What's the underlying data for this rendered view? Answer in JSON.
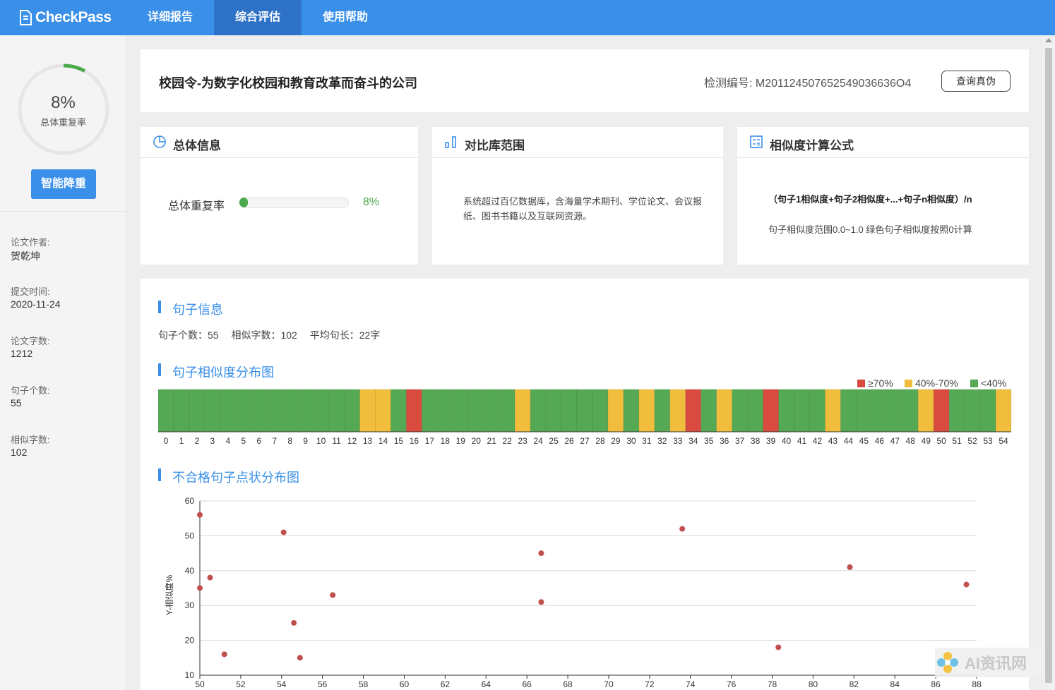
{
  "app": {
    "name": "CheckPass"
  },
  "nav": {
    "tabs": [
      "详细报告",
      "综合评估",
      "使用帮助"
    ],
    "active_tab": "综合评估"
  },
  "sidebar": {
    "overall_rate": "8%",
    "overall_rate_value": 0.08,
    "overall_label": "总体重复率",
    "reduce_button": "智能降重",
    "meta": [
      {
        "label": "论文作者:",
        "value": "贺乾坤"
      },
      {
        "label": "提交时间:",
        "value": "2020-11-24"
      },
      {
        "label": "论文字数:",
        "value": "1212"
      },
      {
        "label": "句子个数:",
        "value": "55"
      },
      {
        "label": "相似字数:",
        "value": "102"
      }
    ]
  },
  "header": {
    "title": "校园令-为数字化校园和教育改革而奋斗的公司",
    "id_label": "检测编号:",
    "id_value": "M201124507652549036636O4",
    "verify_button": "查询真伪"
  },
  "summary": {
    "title": "总体信息",
    "bar_label": "总体重复率",
    "bar_value": 0.08,
    "bar_pct": "8%"
  },
  "scope": {
    "title": "对比库范围",
    "text": "系统超过百亿数据库，含海量学术期刊、学位论文、会议报纸、图书书籍以及互联网资源。"
  },
  "formula": {
    "title": "相似度计算公式",
    "text": "（句子1相似度+句子2相似度+...+句子n相似度）/n",
    "note": "句子相似度范围0.0~1.0 绿色句子相似度按照0计算"
  },
  "sentence_info": {
    "heading": "句子信息",
    "stats": [
      "句子个数：55",
      "相似字数：102",
      "平均句长：22字"
    ]
  },
  "distribution": {
    "heading": "句子相似度分布图",
    "legend": [
      {
        "label": "≥70%",
        "color": "#d84b3e"
      },
      {
        "label": "40%-70%",
        "color": "#f0bd3c"
      },
      {
        "label": "<40%",
        "color": "#55a854"
      }
    ]
  },
  "scatter": {
    "heading": "不合格句子点状分布图"
  },
  "chart_data": [
    {
      "type": "bar",
      "title": "句子相似度分布图",
      "categories": [
        "0",
        "1",
        "2",
        "3",
        "4",
        "5",
        "6",
        "7",
        "8",
        "9",
        "10",
        "11",
        "12",
        "13",
        "14",
        "15",
        "16",
        "17",
        "18",
        "19",
        "20",
        "21",
        "22",
        "23",
        "24",
        "25",
        "26",
        "27",
        "28",
        "29",
        "30",
        "31",
        "32",
        "33",
        "34",
        "35",
        "36",
        "37",
        "38",
        "39",
        "40",
        "41",
        "42",
        "43",
        "44",
        "45",
        "46",
        "47",
        "48",
        "49",
        "50",
        "51",
        "52",
        "53",
        "54"
      ],
      "levels": [
        "green",
        "green",
        "green",
        "green",
        "green",
        "green",
        "green",
        "green",
        "green",
        "green",
        "green",
        "green",
        "green",
        "yellow",
        "yellow",
        "green",
        "red",
        "green",
        "green",
        "green",
        "green",
        "green",
        "green",
        "yellow",
        "green",
        "green",
        "green",
        "green",
        "green",
        "yellow",
        "green",
        "yellow",
        "green",
        "yellow",
        "red",
        "green",
        "yellow",
        "green",
        "green",
        "red",
        "green",
        "green",
        "green",
        "yellow",
        "green",
        "green",
        "green",
        "green",
        "green",
        "yellow",
        "red",
        "green",
        "green",
        "green",
        "yellow"
      ],
      "legend": [
        "≥70%",
        "40%-70%",
        "<40%"
      ],
      "colors": {
        "red": "#d84b3e",
        "yellow": "#f0bd3c",
        "green": "#55a854"
      }
    },
    {
      "type": "scatter",
      "title": "不合格句子点状分布图",
      "ylabel": "Y-相似度%",
      "xlim": [
        50,
        88
      ],
      "ylim": [
        10,
        60
      ],
      "xticks": [
        50,
        52,
        54,
        56,
        58,
        60,
        62,
        64,
        66,
        68,
        70,
        72,
        74,
        76,
        78,
        80,
        82,
        84,
        86,
        88
      ],
      "yticks": [
        10,
        20,
        30,
        40,
        50,
        60
      ],
      "points": [
        [
          50.0,
          56
        ],
        [
          50.0,
          35
        ],
        [
          50.5,
          38
        ],
        [
          51.2,
          16
        ],
        [
          54.1,
          51
        ],
        [
          54.6,
          25
        ],
        [
          54.9,
          15
        ],
        [
          56.5,
          33
        ],
        [
          66.7,
          45
        ],
        [
          66.7,
          31
        ],
        [
          73.6,
          52
        ],
        [
          78.3,
          18
        ],
        [
          81.8,
          41
        ],
        [
          87.5,
          36
        ]
      ],
      "color": "#c0504d"
    }
  ],
  "watermark": {
    "text": "AI资讯网"
  }
}
